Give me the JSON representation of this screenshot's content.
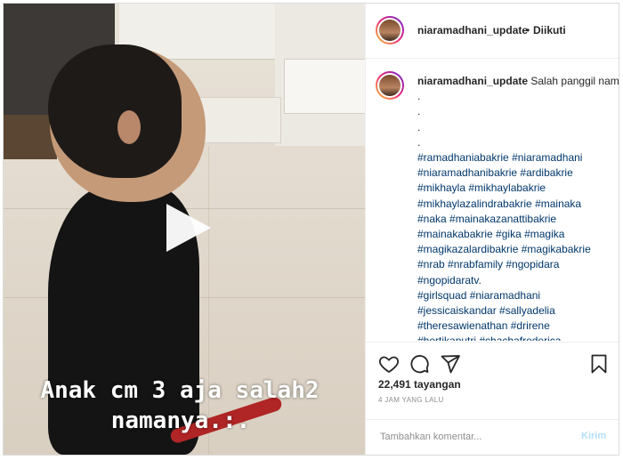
{
  "video": {
    "caption_line1": "Anak cm 3 aja salah2",
    "caption_line2": "namanya.:."
  },
  "header": {
    "username": "niaramadhani_update",
    "separator": "•",
    "follow_status": "Diikuti"
  },
  "post": {
    "username": "niaramadhani_update",
    "caption": "Salah panggil nama hehe🙈😆",
    "dots": [
      ".",
      ".",
      ".",
      "."
    ],
    "hashtag_lines": [
      "#ramadhaniabakrie #niaramadhani",
      "#niaramadhanibakrie #ardibakrie",
      "#mikhayla #mikhaylabakrie",
      "#mikhaylazalindrabakrie #mainaka",
      "#naka #mainakazanattibakrie",
      "#mainakabakrie #gika #magika",
      "#magikazalardibakrie #magikabakrie",
      "#nrab #nrabfamily #ngopidara",
      "#ngopidaratv.",
      "#girlsquad #niaramadhani",
      "#jessicaiskandar #sallyadelia",
      "#theresawienathan #drirene",
      "#hertikaputri #chachafrederica",
      "#__ _ _ _ ____ __ _ ___"
    ]
  },
  "actions": {
    "like_icon": "heart-icon",
    "comment_icon": "comment-bubble-icon",
    "share_icon": "paper-plane-icon",
    "save_icon": "bookmark-icon",
    "views": "22,491 tayangan",
    "time_ago": "4 JAM YANG LALU"
  },
  "comment_form": {
    "placeholder": "Tambahkan komentar...",
    "post_label": "Kirim"
  },
  "colors": {
    "link": "#00376b",
    "post_button_disabled": "#b2dffc",
    "text": "#262626",
    "muted": "#8e8e8e"
  }
}
